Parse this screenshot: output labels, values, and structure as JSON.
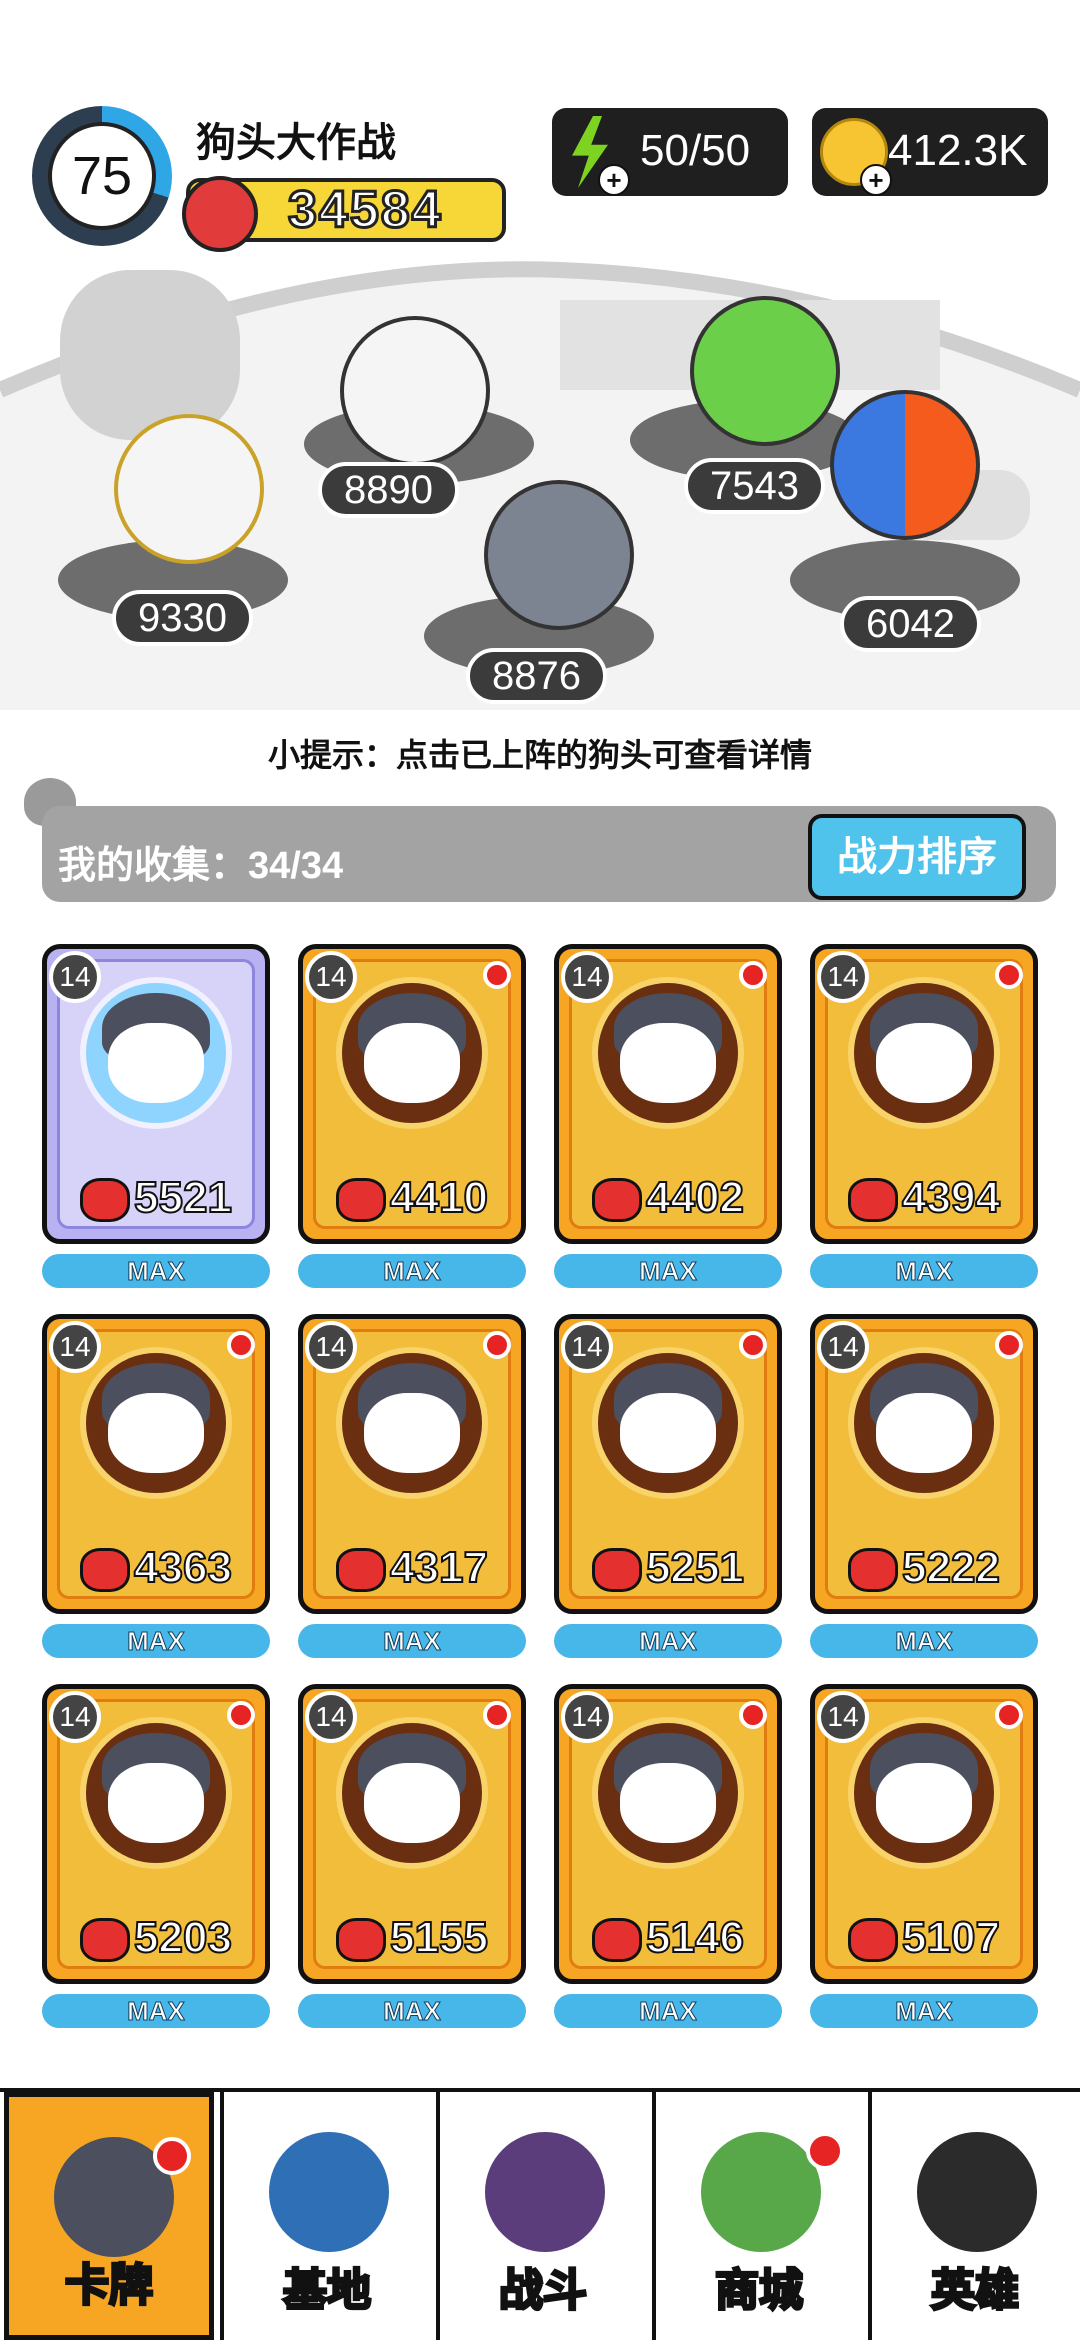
{
  "header": {
    "level": "75",
    "game_title": "狗头大作战",
    "total_power": "34584",
    "energy": "50/50",
    "coins": "412.3K"
  },
  "battle": {
    "lineup": [
      {
        "name": "golden-armor-dog",
        "power": "9330"
      },
      {
        "name": "crown-dog",
        "power": "8890"
      },
      {
        "name": "husky-dog",
        "power": "8876"
      },
      {
        "name": "green-dog",
        "power": "7543"
      },
      {
        "name": "fire-ice-dog",
        "power": "6042"
      }
    ],
    "tip": "小提示：点击已上阵的狗头可查看详情"
  },
  "collection": {
    "label": "我的收集：34/34",
    "sort_button": "战力排序",
    "cards": [
      {
        "level": "14",
        "power": "5521",
        "status": "MAX",
        "style": "purple",
        "dot": false
      },
      {
        "level": "14",
        "power": "4410",
        "status": "MAX",
        "style": "gold",
        "dot": true
      },
      {
        "level": "14",
        "power": "4402",
        "status": "MAX",
        "style": "gold",
        "dot": true
      },
      {
        "level": "14",
        "power": "4394",
        "status": "MAX",
        "style": "gold",
        "dot": true
      },
      {
        "level": "14",
        "power": "4363",
        "status": "MAX",
        "style": "gold",
        "dot": true
      },
      {
        "level": "14",
        "power": "4317",
        "status": "MAX",
        "style": "gold",
        "dot": true
      },
      {
        "level": "14",
        "power": "5251",
        "status": "MAX",
        "style": "gold",
        "dot": true
      },
      {
        "level": "14",
        "power": "5222",
        "status": "MAX",
        "style": "gold",
        "dot": true
      },
      {
        "level": "14",
        "power": "5203",
        "status": "MAX",
        "style": "gold",
        "dot": true
      },
      {
        "level": "14",
        "power": "5155",
        "status": "MAX",
        "style": "gold",
        "dot": true
      },
      {
        "level": "14",
        "power": "5146",
        "status": "MAX",
        "style": "gold",
        "dot": true
      },
      {
        "level": "14",
        "power": "5107",
        "status": "MAX",
        "style": "gold",
        "dot": true
      }
    ]
  },
  "nav": {
    "items": [
      {
        "label": "卡牌",
        "icon": "dog-card-icon",
        "active": true,
        "dot": true
      },
      {
        "label": "基地",
        "icon": "castle-icon",
        "active": false,
        "dot": false
      },
      {
        "label": "战斗",
        "icon": "paw-icon",
        "active": false,
        "dot": false
      },
      {
        "label": "商城",
        "icon": "money-icon",
        "active": false,
        "dot": true
      },
      {
        "label": "英雄",
        "icon": "top-hat-dog-icon",
        "active": false,
        "dot": false
      }
    ]
  },
  "colors": {
    "accent_blue": "#4fc3ec",
    "card_gold": "#f6a623",
    "card_purple": "#b9b2f2",
    "badge_red": "#e62424"
  }
}
